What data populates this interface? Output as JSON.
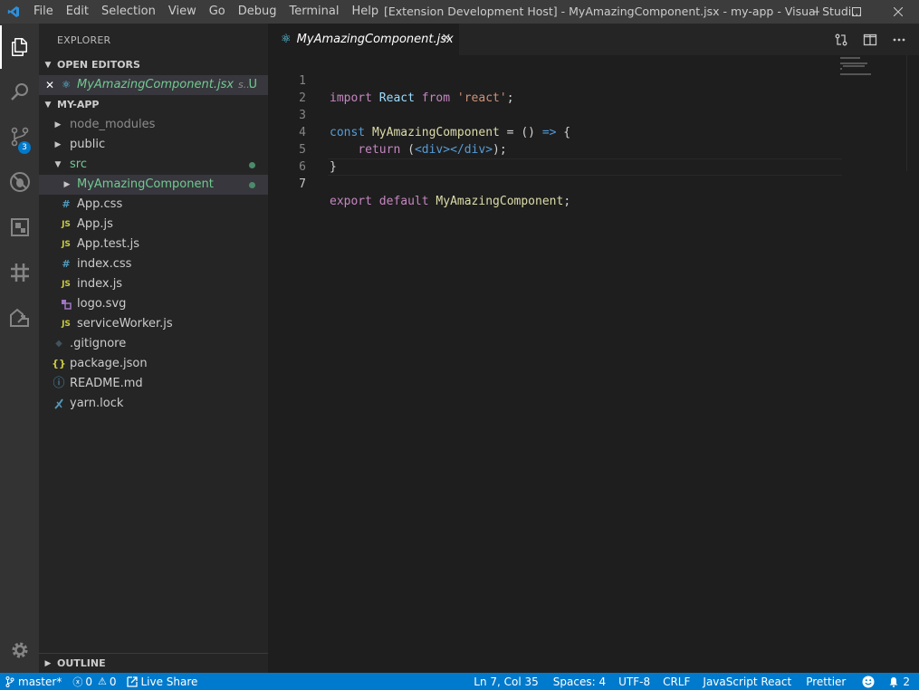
{
  "titlebar": {
    "menu": [
      "File",
      "Edit",
      "Selection",
      "View",
      "Go",
      "Debug",
      "Terminal",
      "Help"
    ],
    "title": "[Extension Development Host] - MyAmazingComponent.jsx - my-app - Visual Studi..."
  },
  "activitybar": {
    "items": [
      "explorer-icon",
      "search-icon",
      "source-control-icon",
      "debug-icon",
      "extensions-icon",
      "git-graph-icon",
      "live-share-icon"
    ],
    "source_control_badge": "3",
    "settings": "gear-icon"
  },
  "sidebar": {
    "title": "EXPLORER",
    "open_editors": {
      "header": "OPEN EDITORS",
      "items": [
        {
          "label": "MyAmazingComponent.jsx",
          "path": "s...",
          "status": "U"
        }
      ]
    },
    "folder": {
      "header": "MY-APP",
      "tree": [
        {
          "label": "node_modules",
          "icon": "",
          "indent": 0,
          "folder": true
        },
        {
          "label": "public",
          "icon": "",
          "indent": 0,
          "folder": true
        },
        {
          "label": "src",
          "icon": "",
          "indent": 0,
          "folder": true,
          "open": true
        },
        {
          "label": "MyAmazingComponent",
          "icon": "",
          "indent": 1,
          "folder": true
        },
        {
          "label": "App.css",
          "icon": "#",
          "indent": 1
        },
        {
          "label": "App.js",
          "icon": "JS",
          "indent": 1
        },
        {
          "label": "App.test.js",
          "icon": "JS",
          "indent": 1
        },
        {
          "label": "index.css",
          "icon": "#",
          "indent": 1
        },
        {
          "label": "index.js",
          "icon": "JS",
          "indent": 1
        },
        {
          "label": "logo.svg",
          "icon": "svg",
          "indent": 1
        },
        {
          "label": "serviceWorker.js",
          "icon": "JS",
          "indent": 1
        },
        {
          "label": ".gitignore",
          "icon": "◆",
          "indent": 0
        },
        {
          "label": "package.json",
          "icon": "{}",
          "indent": 0
        },
        {
          "label": "README.md",
          "icon": "ⓘ",
          "indent": 0
        },
        {
          "label": "yarn.lock",
          "icon": "yarn",
          "indent": 0
        }
      ]
    },
    "outline_header": "OUTLINE"
  },
  "editor": {
    "tab_label": "MyAmazingComponent.jsx",
    "tab_close": "✕",
    "line_numbers": [
      "1",
      "2",
      "3",
      "4",
      "5",
      "6",
      "7"
    ],
    "code": {
      "l1_import": "import",
      "l1_react": "React",
      "l1_from": "from",
      "l1_str": "'react'",
      "l1_semi": ";",
      "l3_const": "const",
      "l3_name": "MyAmazingComponent",
      "l3_eq": " = () ",
      "l3_arrow": "=>",
      "l3_brace": " {",
      "l4_return": "return",
      "l4_paren": " (",
      "l4_open": "<div>",
      "l4_close": "</div>",
      "l4_end": ");",
      "l5_brace": "}",
      "l7_export": "export",
      "l7_default": "default",
      "l7_name": "MyAmazingComponent",
      "l7_semi": ";"
    }
  },
  "statusbar": {
    "branch": "master*",
    "errors": "0",
    "warnings": "0",
    "live_share": "Live Share",
    "position": "Ln 7, Col 35",
    "spaces": "Spaces: 4",
    "encoding": "UTF-8",
    "eol": "CRLF",
    "language": "JavaScript React",
    "formatter": "Prettier",
    "notifications": "2"
  },
  "colors": {
    "accent": "#007acc",
    "untracked": "#73c991"
  }
}
